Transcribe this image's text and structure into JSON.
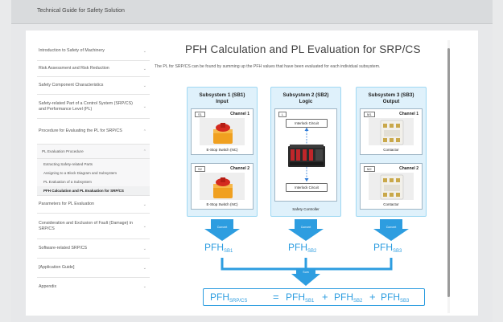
{
  "header": {
    "title": "Technical Guide for Safety Solution"
  },
  "sidebar": {
    "items": [
      {
        "label": "Introduction to Safety of Machinery"
      },
      {
        "label": "Risk Assessment and Risk Reduction"
      },
      {
        "label": "Safety Component Characteristics"
      },
      {
        "label": "Safety-related Part of a Control System (SRP/CS) and Performance Level (PL)"
      },
      {
        "label": "Procedure for Evaluating the PL for SRP/CS"
      }
    ],
    "subgroup": {
      "label": "PL Evaluation Procedure"
    },
    "subitems": [
      {
        "label": "Extracting Safety-related Parts"
      },
      {
        "label": "Assigning to a Block Diagram and Subsystem"
      },
      {
        "label": "PL Evaluation of a Subsystem"
      },
      {
        "label": "PFH Calculation and PL Evaluation for SRP/CS"
      }
    ],
    "items_after": [
      {
        "label": "Parameters for PL Evaluation"
      },
      {
        "label": "Consideration and Exclusion of Fault (Damage) in SRP/CS"
      },
      {
        "label": "Software-related SRP/CS"
      },
      {
        "label": "[Application Guide]"
      },
      {
        "label": "Appendix"
      }
    ]
  },
  "main": {
    "title": "PFH Calculation and PL Evaluation for SRP/CS",
    "intro": "The PL for SRP/CS can be found by summing up the PFH values that have been evaluated for each individual subsystem."
  },
  "diagram": {
    "subsystems": [
      {
        "title_line1": "Subsystem 1 (SB1)",
        "title_line2": "Input",
        "ch1": {
          "tag": "S1",
          "label": "Channel 1",
          "caption": "E-Stop Switch (NC)"
        },
        "ch2": {
          "tag": "S2",
          "label": "Channel 2",
          "caption": "E-Stop Switch (NC)"
        },
        "arrow": "Convert",
        "pfh": "PFH",
        "pfh_sub": "SB1"
      },
      {
        "title_line1": "Subsystem 2 (SB2)",
        "title_line2": "Logic",
        "tag": "L",
        "interlock_top": "Interlock Circuit",
        "interlock_bottom": "Interlock Circuit",
        "caption": "Safety Controller",
        "arrow": "Convert",
        "pfh": "PFH",
        "pfh_sub": "SB2"
      },
      {
        "title_line1": "Subsystem 3 (SB3)",
        "title_line2": "Output",
        "ch1": {
          "tag": "M1",
          "label": "Channel 1",
          "caption": "Contactor"
        },
        "ch2": {
          "tag": "M2",
          "label": "Channel 2",
          "caption": "Contactor"
        },
        "arrow": "Convert",
        "pfh": "PFH",
        "pfh_sub": "SB3"
      }
    ],
    "sum_label": "Sum",
    "formula": {
      "lhs": "PFH",
      "lhs_sub": "SRP/CS",
      "eq": "=",
      "t1": "PFH",
      "t1_sub": "SB1",
      "plus1": "+",
      "t2": "PFH",
      "t2_sub": "SB2",
      "plus2": "+",
      "t3": "PFH",
      "t3_sub": "SB3"
    },
    "colors": {
      "accent": "#2d9de0",
      "panel_bg": "#dff1fb",
      "panel_border": "#9fd8f3"
    }
  }
}
